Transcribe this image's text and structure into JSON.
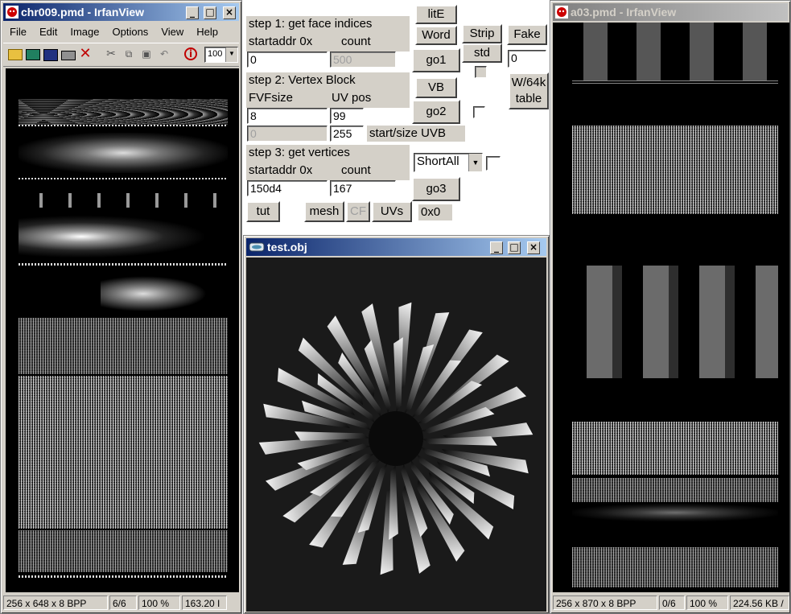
{
  "left_window": {
    "title": "chr009.pmd - IrfanView",
    "menu": [
      "File",
      "Edit",
      "Image",
      "Options",
      "View",
      "Help"
    ],
    "zoom_value": "100",
    "status": [
      "256 x 648 x 8 BPP",
      "6/6",
      "100 %",
      "163.20 I"
    ]
  },
  "right_window": {
    "title": "a03.pmd - IrfanView",
    "status": [
      "256 x 870 x 8 BPP",
      "0/6",
      "100 %",
      "224.56 KB /"
    ]
  },
  "obj_window": {
    "title": "test.obj"
  },
  "panel": {
    "step1_title": "step 1: get face indices",
    "startaddr_label": "startaddr 0x",
    "count_label": "count",
    "step1_startaddr": "0",
    "step1_count": "500",
    "lite_btn": "litE",
    "word_btn": "Word",
    "go1_btn": "go1",
    "strip_btn": "Strip",
    "std_btn": "std",
    "fake_btn": "Fake",
    "fake_value": "0",
    "step2_title": "step 2: Vertex Block",
    "fvfsize_label": "FVFsize",
    "uvpos_label": "UV pos",
    "fvfsize_value": "8",
    "uvpos_value": "99",
    "uvb_start": "0",
    "uvb_size": "255",
    "uvb_label": "start/size UVB",
    "vb_btn": "VB",
    "go2_btn": "go2",
    "w64k_line1": "W/64k",
    "w64k_line2": "table",
    "step3_title": "step 3: get vertices",
    "step3_startaddr_label": "startaddr 0x",
    "step3_count_label": "count",
    "step3_startaddr": "150d4",
    "step3_count": "167",
    "select_value": "ShortAll",
    "go3_btn": "go3",
    "tut_btn": "tut",
    "mesh_btn": "mesh",
    "cf_btn": "CF",
    "uvs_btn": "UVs",
    "hex_readout": "0x0"
  },
  "icons": {
    "app_icon": "irfanview-red-cat-icon",
    "obj_icon": "viewer-app-icon",
    "minimize": "minimize-icon",
    "maximize": "maximize-icon",
    "close": "close-icon",
    "dropdown": "chevron-down-icon"
  },
  "colors": {
    "active_title": "#0a246a",
    "inactive_title": "#808080",
    "face": "#d4d0c8"
  }
}
